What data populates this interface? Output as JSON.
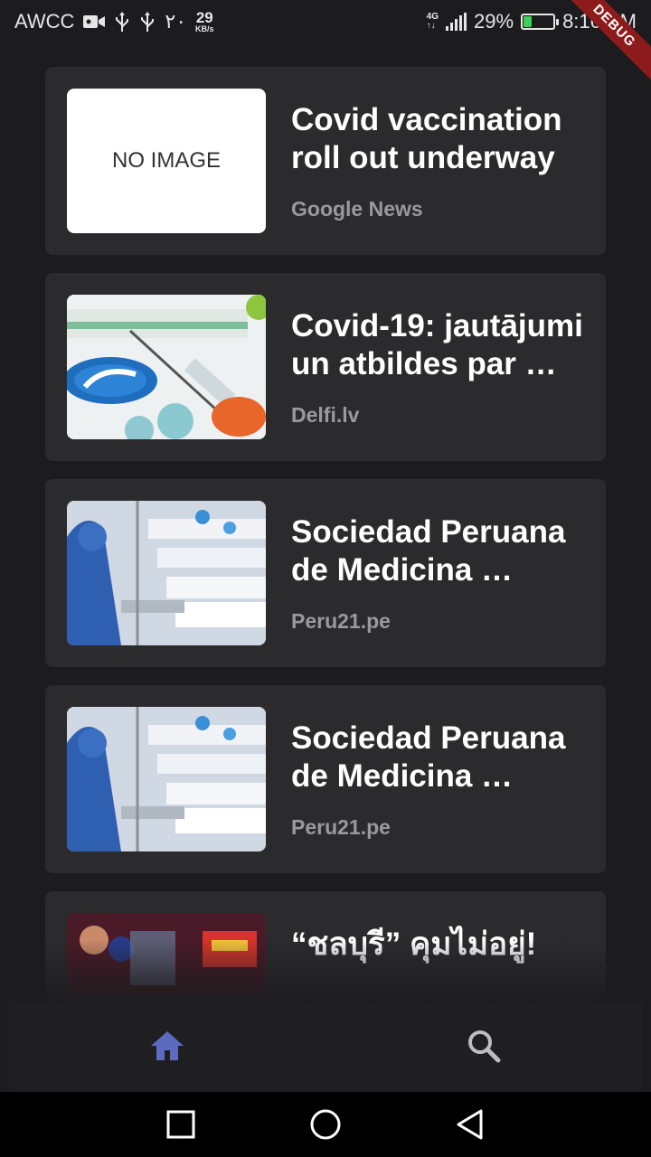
{
  "status_bar": {
    "carrier": "AWCC",
    "arabic_number": "٢٠",
    "speed_value": "29",
    "speed_unit": "KB/s",
    "network_top": "4G",
    "network_bottom": "↑↓",
    "battery_percent": "29%",
    "battery_level": 0.29,
    "time": "8:16 PM"
  },
  "debug_label": "DEBUG",
  "feed": {
    "items": [
      {
        "title": "Covid vaccination roll out underway …",
        "source": "Google News",
        "thumbnail": "no-image",
        "placeholder": "NO IMAGE"
      },
      {
        "title": "Covid-19: jautājumi un atbildes par …",
        "source": "Delfi.lv",
        "thumbnail": "vaccine-photo"
      },
      {
        "title": "Sociedad Peruana de Medicina …",
        "source": "Peru21.pe",
        "thumbnail": "hospital-photo"
      },
      {
        "title": "Sociedad Peruana de Medicina …",
        "source": "Peru21.pe",
        "thumbnail": "hospital-photo"
      },
      {
        "title": "“ชลบุรี” คุมไม่อยู่!",
        "source": "",
        "thumbnail": "news-photo"
      }
    ]
  },
  "bottom_nav": {
    "active_color": "#5c6bc0",
    "inactive_color": "#bdbdbd",
    "items": [
      {
        "icon": "home-icon",
        "active": true
      },
      {
        "icon": "search-icon",
        "active": false
      }
    ]
  },
  "system_nav": [
    "recent-apps",
    "home",
    "back"
  ]
}
